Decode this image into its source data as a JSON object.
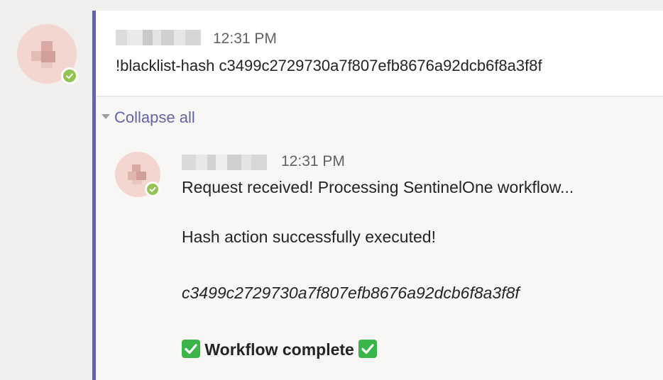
{
  "main_post": {
    "time": "12:31 PM",
    "message": "!blacklist-hash c3499c2729730a7f807efb8676a92dcb6f8a3f8f"
  },
  "collapse": {
    "label": "Collapse all"
  },
  "reply": {
    "time": "12:31 PM",
    "line1": "Request received! Processing SentinelOne workflow...",
    "line2": "Hash action successfully executed!",
    "hash": "c3499c2729730a7f807efb8676a92dcb6f8a3f8f",
    "complete": "Workflow complete"
  },
  "colors": {
    "accent": "#6264a7",
    "presence": "#92c353",
    "check_emoji": "#3bb54a",
    "background": "#f0efee"
  },
  "icons": {
    "presence": "available-check-icon",
    "collapse": "caret-down-icon",
    "emoji": "white-check-mark-icon"
  }
}
